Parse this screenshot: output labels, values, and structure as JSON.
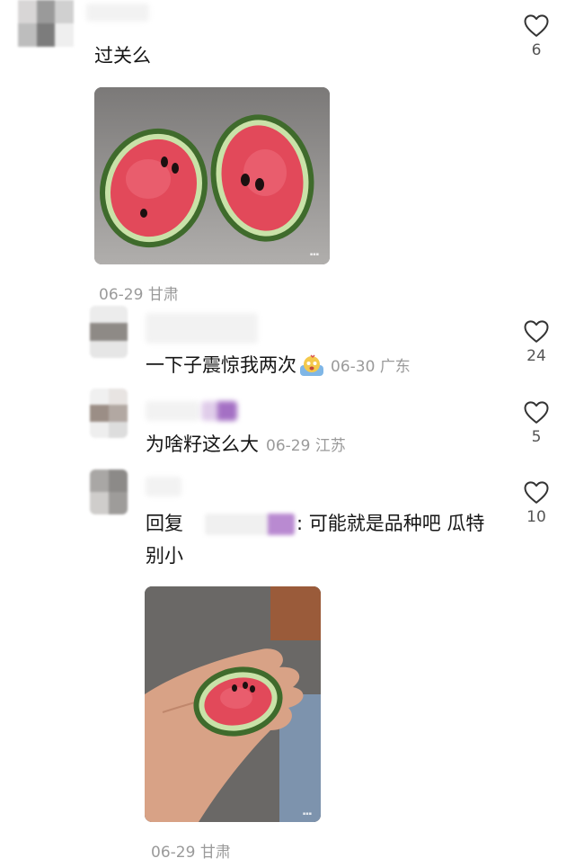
{
  "comments": [
    {
      "text": "过关么",
      "date": "06-29",
      "location": "甘肃",
      "likes": "6"
    },
    {
      "text": "一下子震惊我两次",
      "date": "06-30",
      "location": "广东",
      "likes": "24",
      "emoji": "scared-face-emoji"
    },
    {
      "text": "为啥籽这么大",
      "date": "06-29",
      "location": "江苏",
      "likes": "5"
    },
    {
      "reply_prefix": "回复",
      "text_line1": ": 可能就是品种吧 瓜特",
      "text_line2": "别小",
      "date": "06-29",
      "location": "甘肃",
      "likes": "10"
    }
  ],
  "icons": {
    "like": "heart-outline-icon"
  },
  "colors": {
    "text": "#161616",
    "meta": "#9a9a9a",
    "heart": "#333333"
  }
}
